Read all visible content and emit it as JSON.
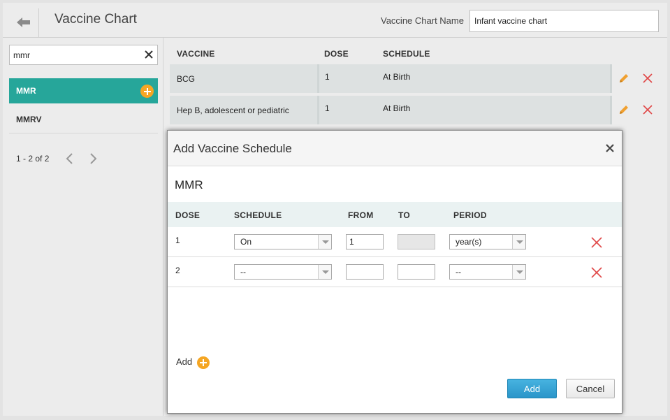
{
  "header": {
    "title": "Vaccine Chart",
    "chart_name_label": "Vaccine Chart Name",
    "chart_name_value": "Infant vaccine chart"
  },
  "sidebar": {
    "search_value": "mmr",
    "items": [
      {
        "label": "MMR",
        "selected": true
      },
      {
        "label": "MMRV",
        "selected": false
      }
    ],
    "pager_text": "1 - 2 of 2"
  },
  "table": {
    "columns": [
      "VACCINE",
      "DOSE",
      "SCHEDULE"
    ],
    "rows": [
      {
        "vaccine": "BCG",
        "dose": "1",
        "schedule": "At Birth"
      },
      {
        "vaccine": "Hep B, adolescent or pediatric",
        "dose": "1",
        "schedule": "At Birth"
      }
    ]
  },
  "modal": {
    "title": "Add Vaccine Schedule",
    "vaccine_name": "MMR",
    "columns": [
      "DOSE",
      "SCHEDULE",
      "FROM",
      "TO",
      "PERIOD"
    ],
    "rows": [
      {
        "dose": "1",
        "schedule": "On",
        "from": "1",
        "to": "",
        "period": "year(s)"
      },
      {
        "dose": "2",
        "schedule": "--",
        "from": "",
        "to": "",
        "period": "--"
      }
    ],
    "add_label": "Add",
    "add_button": "Add",
    "cancel_button": "Cancel"
  },
  "colors": {
    "accent_teal": "#26a69a",
    "add_orange": "#f5a623",
    "primary_blue": "#2a95c9",
    "remove_red": "#e04848",
    "edit_orange": "#f0a030"
  }
}
